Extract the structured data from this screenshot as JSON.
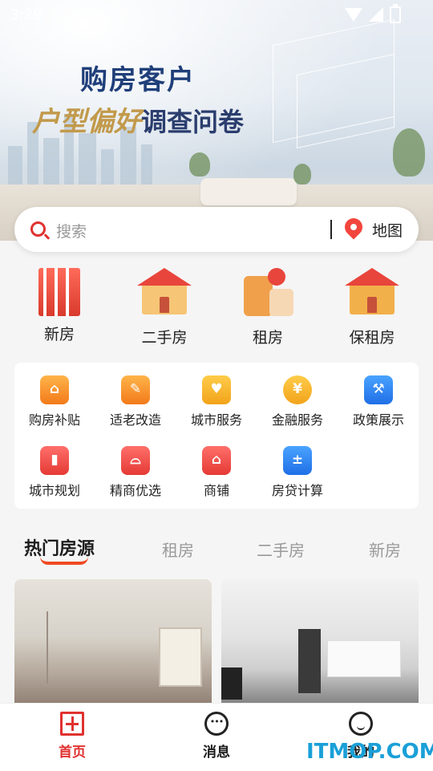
{
  "status": {
    "time": "3:29"
  },
  "banner": {
    "title": "购房客户",
    "subtitle_highlight": "户型偏好",
    "subtitle_rest": "调查问卷"
  },
  "search": {
    "placeholder": "搜索",
    "map_label": "地图"
  },
  "main_categories": [
    {
      "label": "新房",
      "icon": "building-icon"
    },
    {
      "label": "二手房",
      "icon": "house-icon"
    },
    {
      "label": "租房",
      "icon": "suitcase-icon"
    },
    {
      "label": "保租房",
      "icon": "rental-house-icon"
    }
  ],
  "services": [
    {
      "label": "购房补贴",
      "icon": "subsidy-icon",
      "color": "#f27a1a"
    },
    {
      "label": "适老改造",
      "icon": "renovation-icon",
      "color": "#f27a1a"
    },
    {
      "label": "城市服务",
      "icon": "city-service-icon",
      "color": "#f2a31a"
    },
    {
      "label": "金融服务",
      "icon": "finance-icon",
      "color": "#f2a31a"
    },
    {
      "label": "政策展示",
      "icon": "gavel-icon",
      "color": "#1f6fe6"
    },
    {
      "label": "城市规划",
      "icon": "planning-icon",
      "color": "#e53a35"
    },
    {
      "label": "精商优选",
      "icon": "armchair-icon",
      "color": "#e53a35"
    },
    {
      "label": "商铺",
      "icon": "shop-icon",
      "color": "#e53a35"
    },
    {
      "label": "房贷计算",
      "icon": "calculator-icon",
      "color": "#1f6fe6"
    }
  ],
  "tabs": [
    {
      "label": "热门房源",
      "active": true
    },
    {
      "label": "租房",
      "active": false
    },
    {
      "label": "二手房",
      "active": false
    },
    {
      "label": "新房",
      "active": false
    }
  ],
  "bottom_nav": [
    {
      "label": "首页",
      "icon": "home-icon",
      "active": true
    },
    {
      "label": "消息",
      "icon": "message-icon",
      "active": false
    },
    {
      "label": "我的",
      "icon": "profile-icon",
      "active": false
    }
  ],
  "watermark": "ITMOP.COM",
  "colors": {
    "accent": "#e0322f",
    "tab_underline": "#ef4a22",
    "banner_title": "#1f3f7a",
    "banner_gold": "#c29a4c"
  }
}
